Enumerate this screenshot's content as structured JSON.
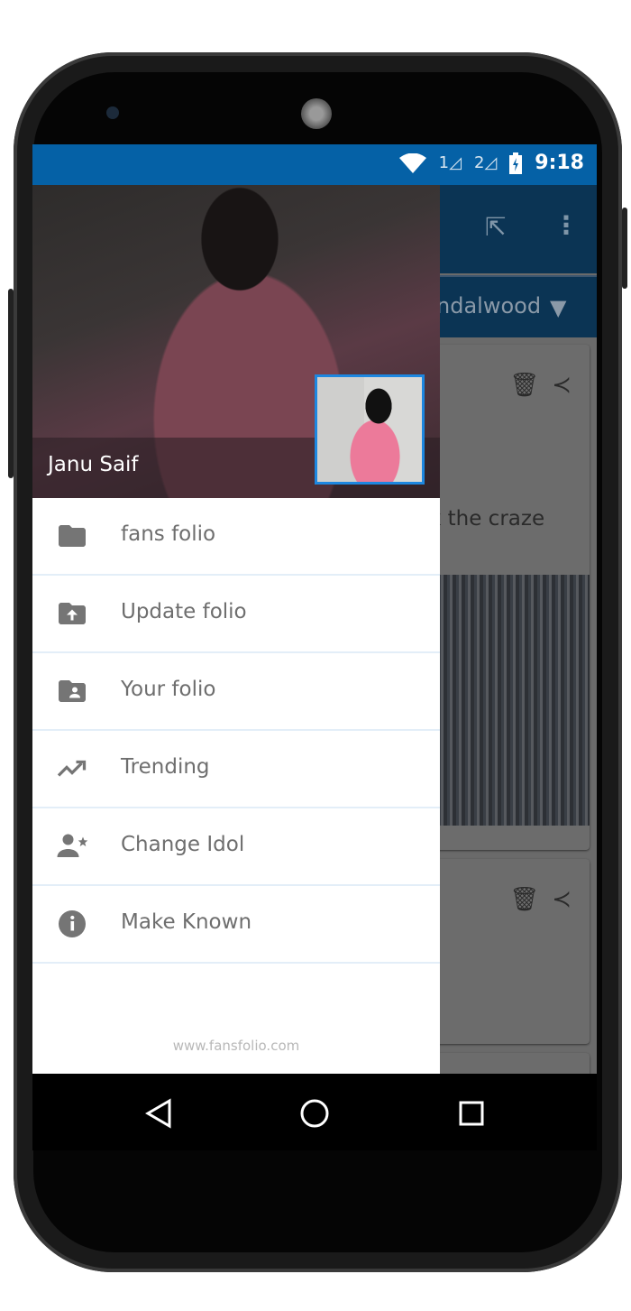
{
  "status_bar": {
    "time": "9:18",
    "sim1": "1",
    "sim2": "2",
    "icons": [
      "wifi-icon",
      "signal-icon",
      "signal-icon",
      "battery-charging-icon"
    ]
  },
  "background_app": {
    "tab_label": "ndalwood",
    "card1_text": "k the craze",
    "colors": {
      "appbar": "#0b3454",
      "status": "#0561a6"
    }
  },
  "drawer": {
    "user_name": "Janu Saif",
    "menu": [
      {
        "label": "fans folio",
        "icon": "folder-icon"
      },
      {
        "label": "Update folio",
        "icon": "folder-upload-icon"
      },
      {
        "label": "Your folio",
        "icon": "folder-account-icon"
      },
      {
        "label": "Trending",
        "icon": "trending-up-icon"
      },
      {
        "label": "Change Idol",
        "icon": "account-star-icon"
      },
      {
        "label": "Make Known",
        "icon": "info-icon"
      }
    ],
    "footer": "www.fansfolio.com"
  },
  "nav": {
    "icons": [
      "back-icon",
      "home-icon",
      "recents-icon"
    ]
  }
}
